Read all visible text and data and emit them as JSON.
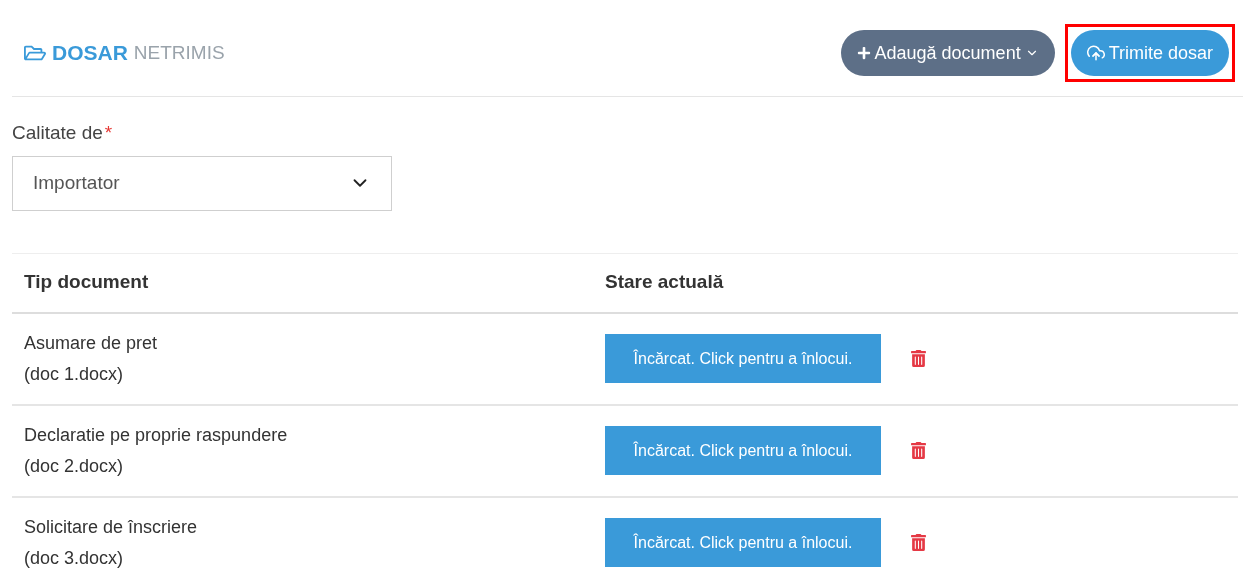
{
  "header": {
    "title": "DOSAR",
    "status": "NETRIMIS"
  },
  "buttons": [
    {
      "label": "Adaugă document",
      "kind": "dropdown",
      "highlighted": false
    },
    {
      "label": "Trimite dosar",
      "kind": "upload",
      "highlighted": true
    }
  ],
  "field": {
    "label": "Calitate de",
    "required_mark": "*",
    "value": "Importator"
  },
  "table": {
    "columns": [
      "Tip document",
      "Stare actuală"
    ],
    "rows": [
      {
        "name": "Asumare de pret",
        "file": "(doc 1.docx)",
        "status": "Încărcat. Click pentru a înlocui."
      },
      {
        "name": "Declaratie pe proprie raspundere",
        "file": "(doc 2.docx)",
        "status": "Încărcat. Click pentru a înlocui."
      },
      {
        "name": "Solicitare de înscriere",
        "file": "(doc 3.docx)",
        "status": "Încărcat. Click pentru a înlocui."
      }
    ]
  }
}
